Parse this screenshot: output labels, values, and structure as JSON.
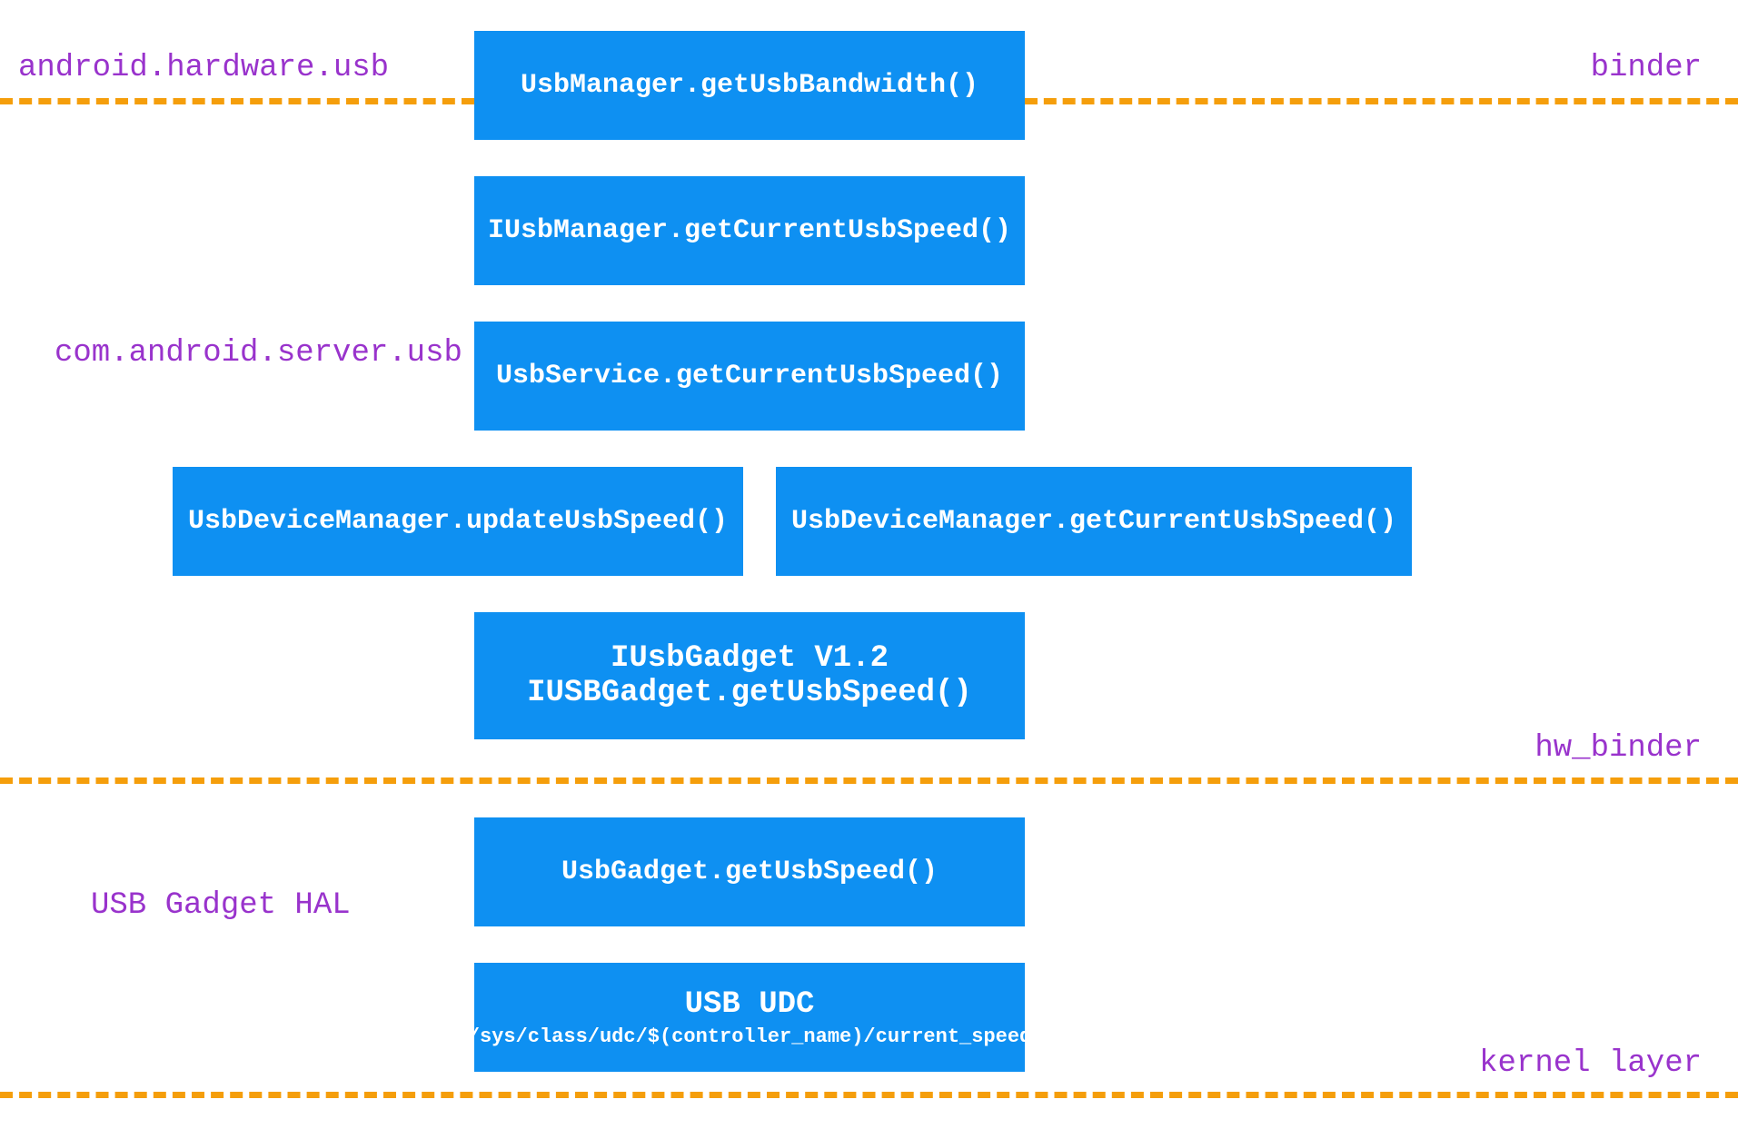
{
  "labels": {
    "top_left": "android.hardware.usb",
    "top_right": "binder",
    "mid_left": "com.android.server.usb",
    "hw_right": "hw_binder",
    "hal_left": "USB Gadget HAL",
    "kernel_right": "kernel layer"
  },
  "boxes": {
    "b1": "UsbManager.getUsbBandwidth()",
    "b2": "IUsbManager.getCurrentUsbSpeed()",
    "b3": "UsbService.getCurrentUsbSpeed()",
    "b4": "UsbDeviceManager.updateUsbSpeed()",
    "b5": "UsbDeviceManager.getCurrentUsbSpeed()",
    "b6_title": "IUsbGadget V1.2",
    "b6_sub": "IUSBGadget.getUsbSpeed()",
    "b7": "UsbGadget.getUsbSpeed()",
    "b8_title": "USB UDC",
    "b8_sub": "/sys/class/udc/$(controller_name)/current_speed"
  }
}
